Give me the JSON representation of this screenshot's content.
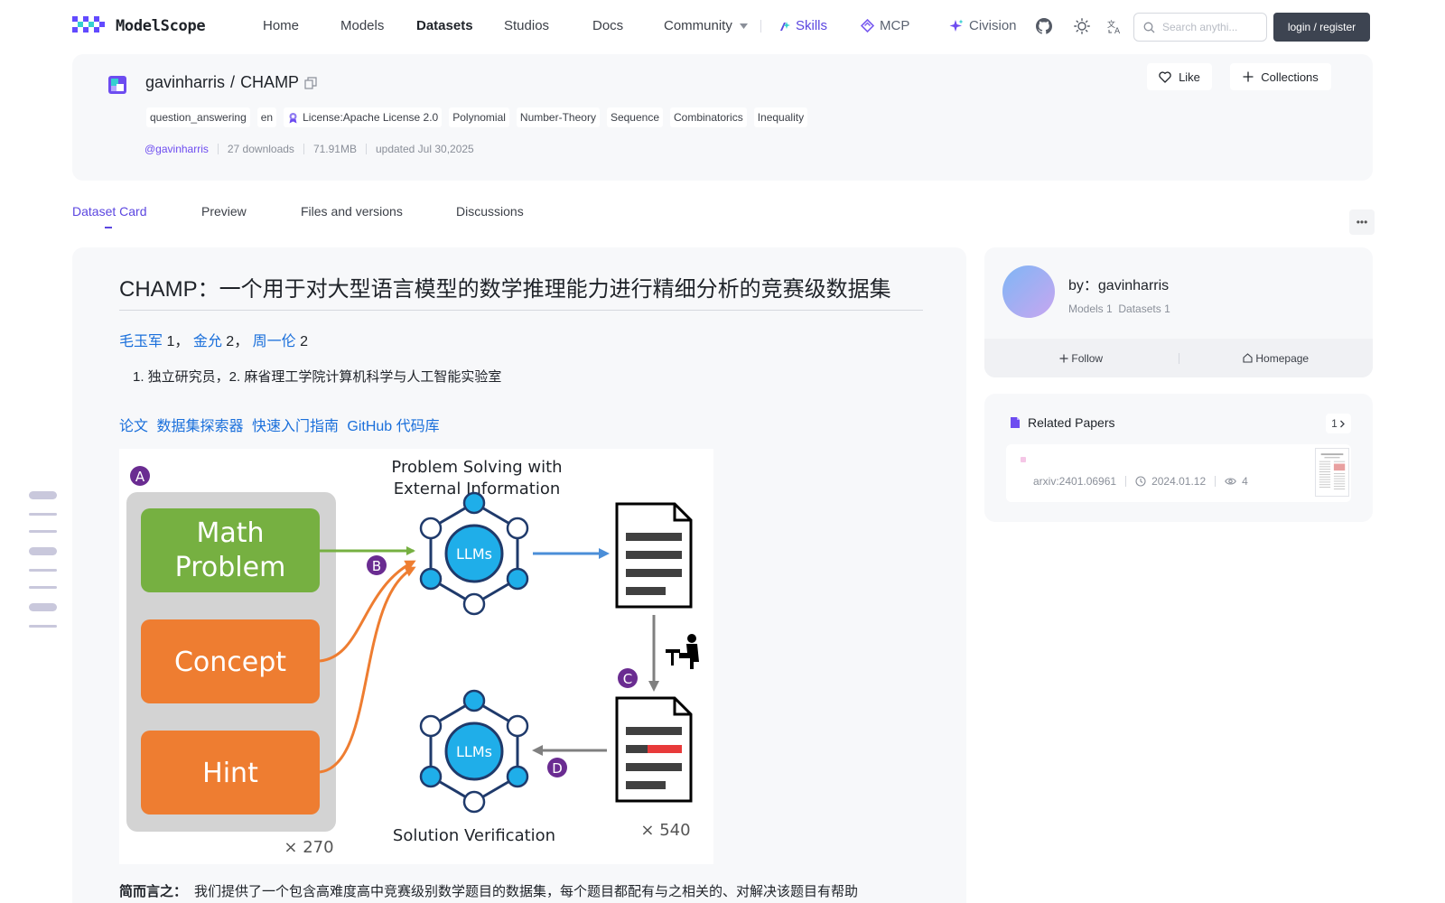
{
  "nav": {
    "brand": "ModelScope",
    "items": [
      {
        "label": "Home",
        "active": false
      },
      {
        "label": "Models",
        "active": false
      },
      {
        "label": "Datasets",
        "active": true
      },
      {
        "label": "Studios",
        "active": false
      },
      {
        "label": "Docs",
        "active": false
      },
      {
        "label": "Community",
        "active": false,
        "dropdown": true
      },
      {
        "label": "Skills",
        "icon": "sparkle-pen-icon"
      },
      {
        "label": "MCP",
        "icon": "mcp-diamond-icon"
      },
      {
        "label": "Civision",
        "icon": "sparkle-icon"
      }
    ],
    "utility_icons": [
      "github-icon",
      "sun-theme-icon",
      "language-icon"
    ],
    "search_placeholder": "Search anythi...",
    "login_label": "login / register"
  },
  "dataset": {
    "owner": "gavinharris",
    "separator": "/",
    "name": "CHAMP",
    "tags": [
      "question_answering",
      "en",
      "License:Apache License 2.0",
      "Polynomial",
      "Number-Theory",
      "Sequence",
      "Combinatorics",
      "Inequality"
    ],
    "author_handle": "@gavinharris",
    "downloads": "27 downloads",
    "size": "71.91MB",
    "updated": "updated Jul 30,2025",
    "like_label": "Like",
    "collections_label": "Collections"
  },
  "tabs": [
    "Dataset Card",
    "Preview",
    "Files and versions",
    "Discussions"
  ],
  "readme": {
    "title": "CHAMP：一个用于对大型语言模型的数学推理能力进行精细分析的竞赛级数据集",
    "authors": [
      {
        "name": "毛玉军",
        "sup": "1"
      },
      {
        "name": "金允",
        "sup": "2"
      },
      {
        "name": "周一伦",
        "sup": "2"
      }
    ],
    "affiliation": "1. 独立研究员，2. 麻省理工学院计算机科学与人工智能实验室",
    "links": [
      "论文",
      "数据集探索器",
      "快速入门指南",
      "GitHub 代码库"
    ],
    "figure": {
      "label_a": "A",
      "label_b": "B",
      "label_c": "C",
      "label_d": "D",
      "title_top_1": "Problem Solving with",
      "title_top_2": "External Information",
      "box_math_1": "Math",
      "box_math_2": "Problem",
      "box_concept": "Concept",
      "box_hint": "Hint",
      "llm_label": "LLMs",
      "count_left": "× 270",
      "count_right": "× 540",
      "title_bottom": "Solution Verification"
    },
    "tldr_label": "简而言之：",
    "tldr_text": "我们提供了一个包含高难度高中竞赛级别数学题目的数据集，每个题目都配有与之相关的、对解决该题目有帮助"
  },
  "sidebar": {
    "by_prefix": "by：",
    "author": "gavinharris",
    "models_count": "Models 1",
    "datasets_count": "Datasets 1",
    "follow_label": "Follow",
    "homepage_label": "Homepage",
    "papers_title": "Related Papers",
    "papers_count": "1",
    "paper": {
      "id": "arxiv:2401.06961",
      "date": "2024.01.12",
      "views": "4"
    }
  },
  "colors": {
    "accent": "#5b46e0",
    "link": "#1a6fdb",
    "math_box": "#76b041",
    "concept_box": "#ee7d31",
    "llm_node": "#1faee9",
    "badge_purple": "#6a2c91"
  }
}
